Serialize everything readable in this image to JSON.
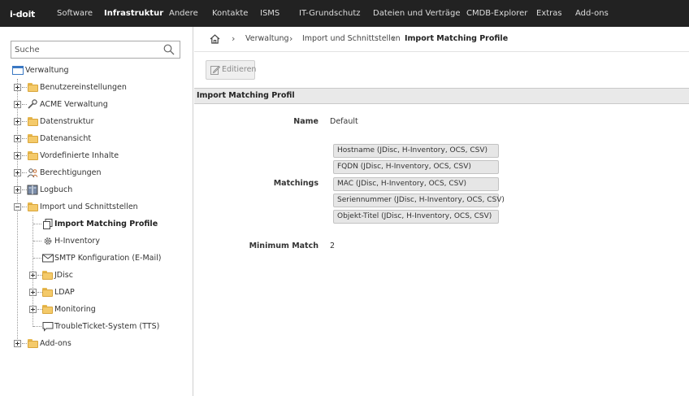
{
  "app": {
    "logo_text": "i-doit"
  },
  "topnav": {
    "items": [
      {
        "label": "Software",
        "active": false
      },
      {
        "label": "Infrastruktur",
        "active": true
      },
      {
        "label": "Andere",
        "active": false
      },
      {
        "label": "Kontakte",
        "active": false
      },
      {
        "label": "ISMS",
        "active": false
      },
      {
        "label": "IT-Grundschutz",
        "active": false
      },
      {
        "label": "Dateien und Verträge",
        "active": false
      },
      {
        "label": "CMDB-Explorer",
        "active": false
      },
      {
        "label": "Extras",
        "active": false
      },
      {
        "label": "Add-ons",
        "active": false
      }
    ]
  },
  "sidebar": {
    "search": {
      "placeholder": "Suche",
      "value": ""
    },
    "root": {
      "label": "Verwaltung",
      "icon": "window-icon"
    },
    "items": [
      {
        "label": "Benutzereinstellungen",
        "icon": "folder-icon"
      },
      {
        "label": "ACME Verwaltung",
        "icon": "wrench-icon"
      },
      {
        "label": "Datenstruktur",
        "icon": "folder-icon"
      },
      {
        "label": "Datenansicht",
        "icon": "folder-icon"
      },
      {
        "label": "Vordefinierte Inhalte",
        "icon": "folder-icon"
      },
      {
        "label": "Berechtigungen",
        "icon": "users-icon"
      },
      {
        "label": "Logbuch",
        "icon": "book-icon"
      },
      {
        "label": "Import und Schnittstellen",
        "icon": "folder-icon"
      },
      {
        "label": "Add-ons",
        "icon": "folder-icon"
      }
    ],
    "import_children": [
      {
        "label": "Import Matching Profile",
        "icon": "copy-icon",
        "selected": true
      },
      {
        "label": "H-Inventory",
        "icon": "gear-icon"
      },
      {
        "label": "SMTP Konfiguration (E-Mail)",
        "icon": "envelope-icon"
      },
      {
        "label": "JDisc",
        "icon": "folder-icon"
      },
      {
        "label": "LDAP",
        "icon": "folder-icon"
      },
      {
        "label": "Monitoring",
        "icon": "folder-icon"
      },
      {
        "label": "TroubleTicket-System (TTS)",
        "icon": "chat-icon"
      }
    ]
  },
  "breadcrumb": {
    "items": [
      "Verwaltung",
      "Import und Schnittstellen",
      "Import Matching Profile"
    ]
  },
  "toolbar": {
    "edit_label": "Editieren",
    "edit_enabled": false
  },
  "section": {
    "title": "Import Matching Profil",
    "name_label": "Name",
    "name_value": "Default",
    "matchings_label": "Matchings",
    "matchings": [
      "Hostname (JDisc, H-Inventory, OCS, CSV)",
      "FQDN (JDisc, H-Inventory, OCS, CSV)",
      "MAC (JDisc, H-Inventory, OCS, CSV)",
      "Seriennummer (JDisc, H-Inventory, OCS, CSV)",
      "Objekt-Titel (JDisc, H-Inventory, OCS, CSV)"
    ],
    "min_match_label": "Minimum Match",
    "min_match_value": "2"
  },
  "colors": {
    "topbar_bg": "#222222",
    "folder": "#f4ca6a",
    "section_header_bg": "#e9e9e9",
    "match_item_bg": "#e6e6e6"
  }
}
